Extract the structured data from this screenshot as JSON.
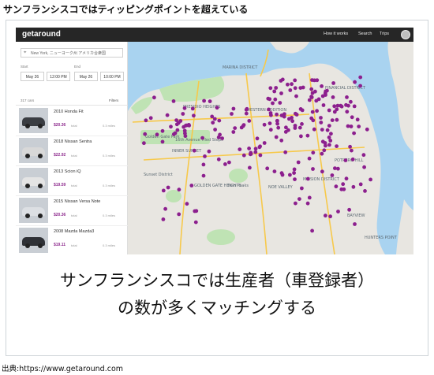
{
  "slide": {
    "title": "サンフランシスコではティッピングポイントを超えている",
    "caption_line1": "サンフランシスコでは生産者（車登録者）",
    "caption_line2": "の数が多くマッチングする",
    "source": "出典:https://www.getaround.com"
  },
  "app": {
    "logo": "getaround",
    "nav": [
      "How it works",
      "Search",
      "Trips"
    ],
    "location_value": "New York, ニューヨーク州 アメリカ合衆国",
    "start_label": "Start",
    "end_label": "End",
    "start_date": "May 26",
    "start_time": "12:00 PM",
    "end_date": "May 26",
    "end_time": "10:00 PM",
    "car_count": "317 cars",
    "filters_label": "Filters",
    "cars": [
      {
        "name": "2010 Honda Fit",
        "price": "$20.36",
        "total": "total",
        "distance": "0.3 miles",
        "color": "#3a3d42"
      },
      {
        "name": "2018 Nissan Sentra",
        "price": "$22.92",
        "total": "total",
        "distance": "0.3 miles",
        "color": "#d8d8d8"
      },
      {
        "name": "2013 Scion iQ",
        "price": "$19.59",
        "total": "total",
        "distance": "0.3 miles",
        "color": "#e4e4e4"
      },
      {
        "name": "2015 Nissan Versa Note",
        "price": "$20.36",
        "total": "total",
        "distance": "0.3 miles",
        "color": "#dcdfe3"
      },
      {
        "name": "2008 Mazda Mazda3",
        "price": "$19.11",
        "total": "total",
        "distance": "0.3 miles",
        "color": "#2f3136"
      }
    ],
    "map": {
      "labels": [
        "Golden Gate Park",
        "Sunset District",
        "16th Avenue Tiled Steps",
        "Twin Peaks",
        "GOLDEN GATE HEIGHTS",
        "INNER SUNSET",
        "PRESIDIO HEIGHTS",
        "WESTERN ADDITION",
        "FINANCIAL DISTRICT",
        "MISSION DISTRICT",
        "POTRERO HILL",
        "BAYVIEW",
        "HUNTERS POINT",
        "MARINA DISTRICT",
        "NOE VALLEY"
      ],
      "land_color": "#e8e6e1",
      "water_color": "#a9d3f0",
      "park_color": "#bfe3b4",
      "pin_color": "#8c1f8e"
    }
  }
}
